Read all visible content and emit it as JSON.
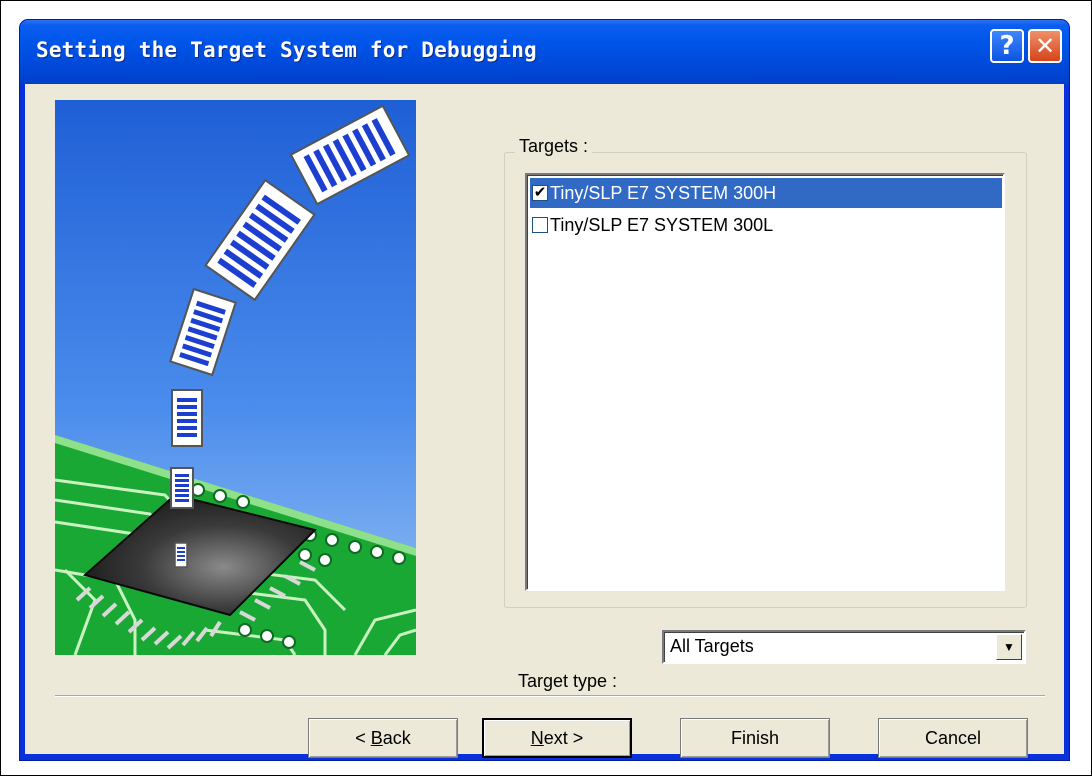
{
  "window": {
    "title": "Setting the Target System for Debugging",
    "help_glyph": "?",
    "close_glyph": "✕"
  },
  "targets_group": {
    "label": "Targets :",
    "items": [
      {
        "label": "Tiny/SLP E7 SYSTEM 300H",
        "checked": true,
        "selected": true
      },
      {
        "label": "Tiny/SLP E7 SYSTEM 300L",
        "checked": false,
        "selected": false
      }
    ]
  },
  "target_type": {
    "label": "Target type :",
    "value": "All Targets"
  },
  "buttons": {
    "back": {
      "pre": "< ",
      "mnemonic": "B",
      "rest": "ack"
    },
    "next": {
      "mnemonic": "N",
      "rest": "ext >"
    },
    "finish": "Finish",
    "cancel": "Cancel"
  },
  "colors": {
    "title_bar": "#0055ea",
    "selection": "#316ac5",
    "dialog_face": "#ece9d8",
    "board_green": "#1aa834",
    "sky_blue": "#3a78e0"
  },
  "icons": {
    "help": "help-icon",
    "close": "close-icon",
    "dropdown": "chevron-down-icon",
    "check": "check-icon"
  }
}
